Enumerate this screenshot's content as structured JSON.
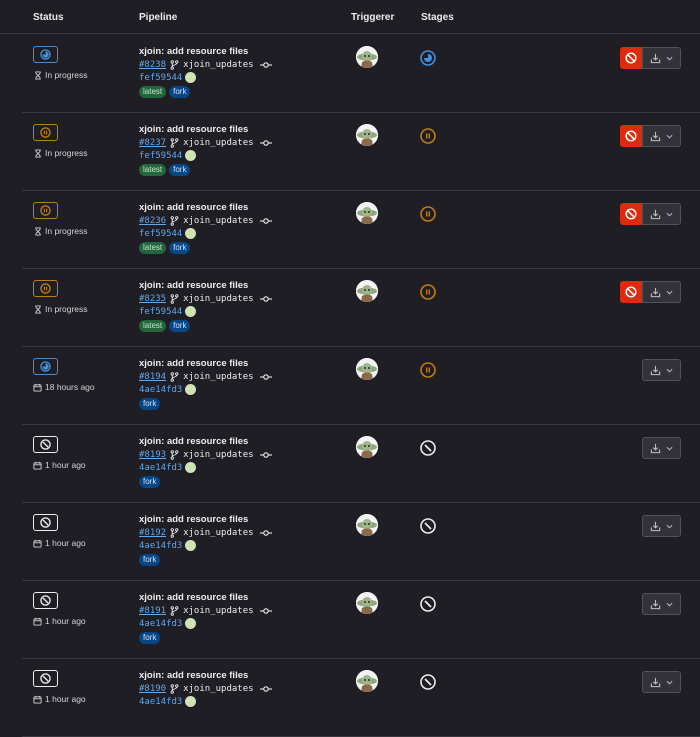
{
  "headers": {
    "status": "Status",
    "pipeline": "Pipeline",
    "triggerer": "Triggerer",
    "stages": "Stages"
  },
  "rows": [
    {
      "status": "running",
      "status_text": "In progress",
      "time_icon": "hourglass-icon",
      "title": "xjoin: add resource files",
      "id": "#8238",
      "branch": "xjoin_updates",
      "sha": "fef59544",
      "tags": [
        "latest",
        "fork"
      ],
      "stage": "running",
      "cancel": true
    },
    {
      "status": "paused",
      "status_text": "In progress",
      "time_icon": "hourglass-icon",
      "title": "xjoin: add resource files",
      "id": "#8237",
      "branch": "xjoin_updates",
      "sha": "fef59544",
      "tags": [
        "latest",
        "fork"
      ],
      "stage": "paused",
      "cancel": true
    },
    {
      "status": "paused",
      "status_text": "In progress",
      "time_icon": "hourglass-icon",
      "title": "xjoin: add resource files",
      "id": "#8236",
      "branch": "xjoin_updates",
      "sha": "fef59544",
      "tags": [
        "latest",
        "fork"
      ],
      "stage": "paused",
      "cancel": true
    },
    {
      "status": "paused",
      "status_text": "In progress",
      "time_icon": "hourglass-icon",
      "title": "xjoin: add resource files",
      "id": "#8235",
      "branch": "xjoin_updates",
      "sha": "fef59544",
      "tags": [
        "latest",
        "fork"
      ],
      "stage": "paused",
      "cancel": true
    },
    {
      "status": "running",
      "status_text": "18 hours ago",
      "time_icon": "calendar-icon",
      "title": "xjoin: add resource files",
      "id": "#8194",
      "branch": "xjoin_updates",
      "sha": "4ae14fd3",
      "tags": [
        "fork"
      ],
      "stage": "paused",
      "cancel": false
    },
    {
      "status": "canceled",
      "status_text": "1 hour ago",
      "time_icon": "calendar-icon",
      "title": "xjoin: add resource files",
      "id": "#8193",
      "branch": "xjoin_updates",
      "sha": "4ae14fd3",
      "tags": [
        "fork"
      ],
      "stage": "canceled",
      "cancel": false
    },
    {
      "status": "canceled",
      "status_text": "1 hour ago",
      "time_icon": "calendar-icon",
      "title": "xjoin: add resource files",
      "id": "#8192",
      "branch": "xjoin_updates",
      "sha": "4ae14fd3",
      "tags": [
        "fork"
      ],
      "stage": "canceled",
      "cancel": false
    },
    {
      "status": "canceled",
      "status_text": "1 hour ago",
      "time_icon": "calendar-icon",
      "title": "xjoin: add resource files",
      "id": "#8191",
      "branch": "xjoin_updates",
      "sha": "4ae14fd3",
      "tags": [
        "fork"
      ],
      "stage": "canceled",
      "cancel": false
    },
    {
      "status": "canceled",
      "status_text": "1 hour ago",
      "time_icon": "calendar-icon",
      "title": "xjoin: add resource files",
      "id": "#8190",
      "branch": "xjoin_updates",
      "sha": "4ae14fd3",
      "tags": [],
      "stage": "canceled",
      "cancel": false
    }
  ],
  "colors": {
    "running": "#428fdc",
    "paused": "#c17d10",
    "canceled": "#ececef",
    "danger": "#dd2b0e",
    "tag_latest_bg": "#24663b",
    "tag_fork_bg": "#064787"
  }
}
